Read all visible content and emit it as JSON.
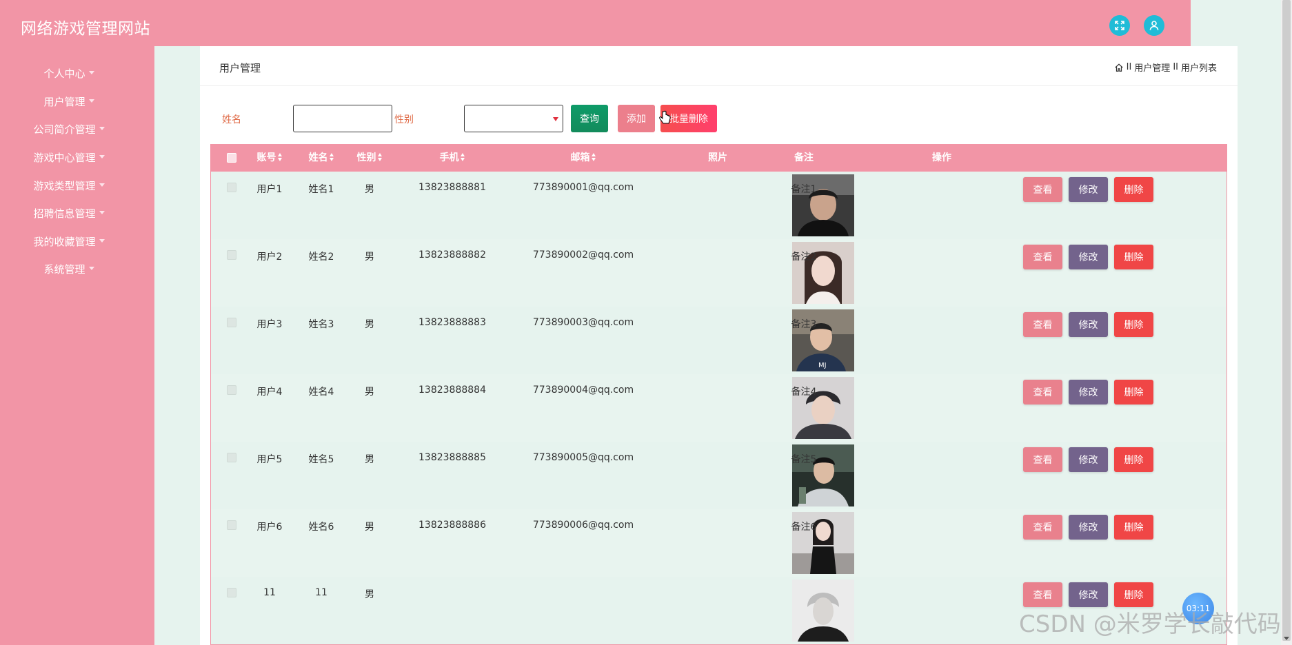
{
  "app": {
    "title": "网络游戏管理网站"
  },
  "header": {
    "fullscreen_icon": "expand-icon",
    "user_icon": "user-icon",
    "accent_color": "#20bcd7"
  },
  "sidebar": {
    "items": [
      {
        "label": "个人中心"
      },
      {
        "label": "用户管理"
      },
      {
        "label": "公司简介管理"
      },
      {
        "label": "游戏中心管理"
      },
      {
        "label": "游戏类型管理"
      },
      {
        "label": "招聘信息管理"
      },
      {
        "label": "我的收藏管理"
      },
      {
        "label": "系统管理"
      }
    ]
  },
  "page": {
    "title": "用户管理",
    "breadcrumb": {
      "sep1": "II",
      "item1": "用户管理",
      "sep2": "II",
      "item2": "用户列表"
    }
  },
  "search": {
    "name_label": "姓名",
    "name_value": "",
    "gender_label": "性别",
    "gender_value": "",
    "query_label": "查询",
    "add_label": "添加",
    "batch_delete_label": "批量删除"
  },
  "table": {
    "columns": {
      "account": "账号",
      "name": "姓名",
      "gender": "性别",
      "phone": "手机",
      "email": "邮箱",
      "photo": "照片",
      "remark": "备注",
      "actions": "操作"
    },
    "action_labels": {
      "view": "查看",
      "edit": "修改",
      "delete": "删除"
    },
    "rows": [
      {
        "account": "用户1",
        "name": "姓名1",
        "gender": "男",
        "phone": "13823888881",
        "email": "773890001@qq.com",
        "remark": "备注1"
      },
      {
        "account": "用户2",
        "name": "姓名2",
        "gender": "男",
        "phone": "13823888882",
        "email": "773890002@qq.com",
        "remark": "备注2"
      },
      {
        "account": "用户3",
        "name": "姓名3",
        "gender": "男",
        "phone": "13823888883",
        "email": "773890003@qq.com",
        "remark": "备注3"
      },
      {
        "account": "用户4",
        "name": "姓名4",
        "gender": "男",
        "phone": "13823888884",
        "email": "773890004@qq.com",
        "remark": "备注4"
      },
      {
        "account": "用户5",
        "name": "姓名5",
        "gender": "男",
        "phone": "13823888885",
        "email": "773890005@qq.com",
        "remark": "备注5"
      },
      {
        "account": "用户6",
        "name": "姓名6",
        "gender": "男",
        "phone": "13823888886",
        "email": "773890006@qq.com",
        "remark": "备注6"
      },
      {
        "account": "11",
        "name": "11",
        "gender": "男",
        "phone": "",
        "email": "",
        "remark": ""
      }
    ]
  },
  "overlay": {
    "timer": "03:11",
    "watermark": "CSDN @米罗学长敲代码"
  },
  "colors": {
    "primary": "#f295a6",
    "background": "#e6f3ee",
    "label": "#e06d4a"
  }
}
